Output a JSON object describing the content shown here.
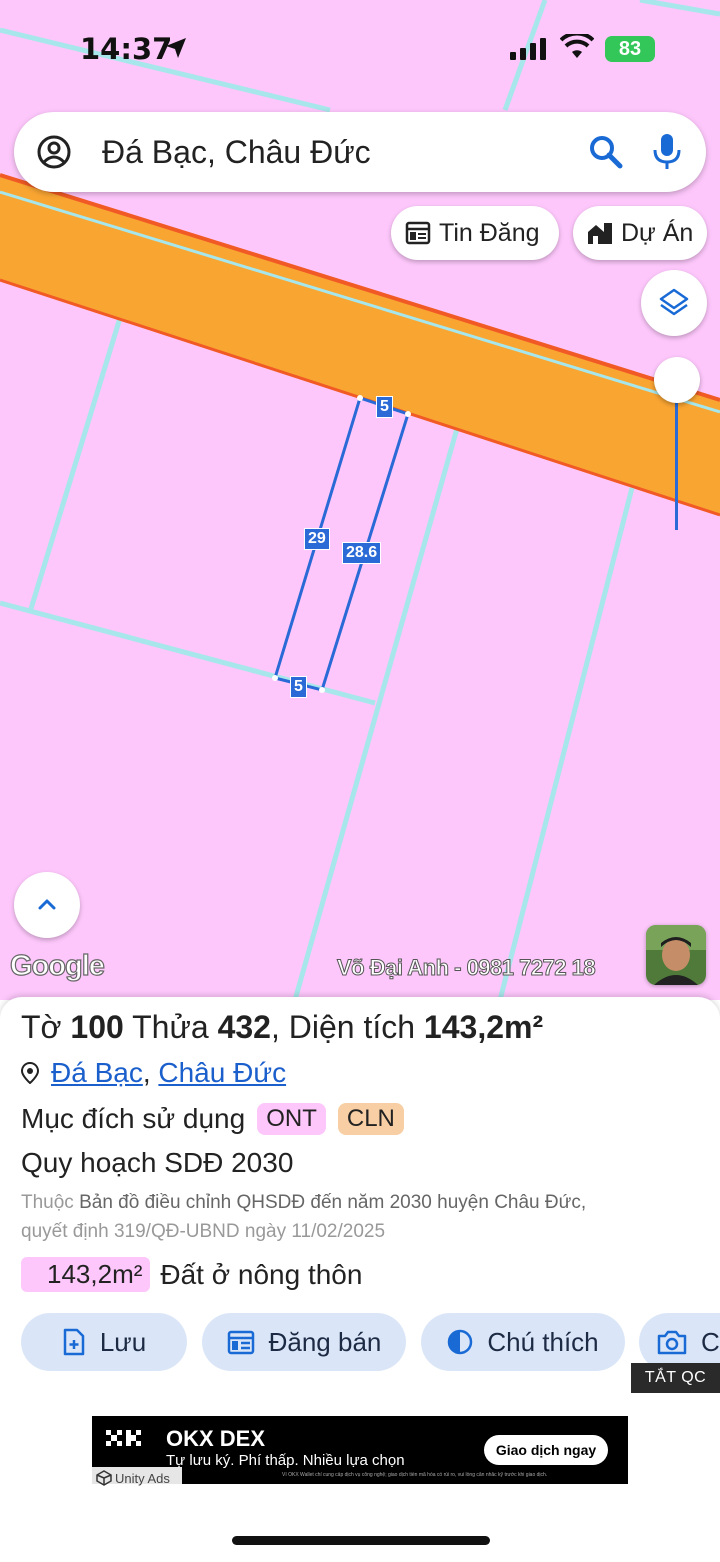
{
  "status_bar": {
    "time": "14:37",
    "battery": "83",
    "battery_color": "#33c759"
  },
  "search": {
    "query": "Đá Bạc, Châu Đức",
    "icons": [
      "account-circle-icon",
      "search-icon",
      "mic-icon"
    ]
  },
  "chips": {
    "listings": "Tin Đăng",
    "projects": "Dự Án"
  },
  "map": {
    "land_color": "#fdc7fb",
    "road_color": "#f9a532",
    "parcel_line_color": "#2a6ad6",
    "segments": {
      "top": "5",
      "left": "29",
      "right": "28.6",
      "bottom": "5"
    },
    "google_label": "Google",
    "watermark": "Võ Đại Anh - 0981 7272 18"
  },
  "parcel": {
    "prefix_sheet": "Tờ",
    "sheet_no": "100",
    "prefix_plot": "Thửa",
    "plot_no": "432",
    "prefix_area": ", Diện tích",
    "area": "143,2m²",
    "commune": "Đá Bạc",
    "district": "Châu Đức",
    "purpose_label": "Mục đích sử dụng",
    "purpose_tags": [
      "ONT",
      "CLN"
    ],
    "plan_title": "Quy hoạch SDĐ 2030",
    "plan_desc_prefix": "Thuộc",
    "plan_desc_line1": "Bản đồ điều chỉnh QHSDĐ đến năm 2030 huyện Châu Đức,",
    "plan_desc_line2": "quyết định 319/QĐ-UBND ngày 11/02/2025",
    "area_value": "143,2m²",
    "area_type": "Đất ở nông thôn"
  },
  "actions": {
    "save": "Lưu",
    "post": "Đăng bán",
    "legend": "Chú thích",
    "camera": "C"
  },
  "ad": {
    "close_label": "TẮT QC",
    "title": "OKX DEX",
    "subtitle": "Tự lưu ký. Phí thấp. Nhiều lựa chọn",
    "cta": "Giao dịch ngay",
    "fine_print": "Ví OKX Wallet chỉ cung cấp dịch vụ công nghệ; giao dịch tiền mã hóa có rủi ro, vui lòng cân nhắc kỹ trước khi giao dịch.",
    "provider": "Unity Ads"
  }
}
